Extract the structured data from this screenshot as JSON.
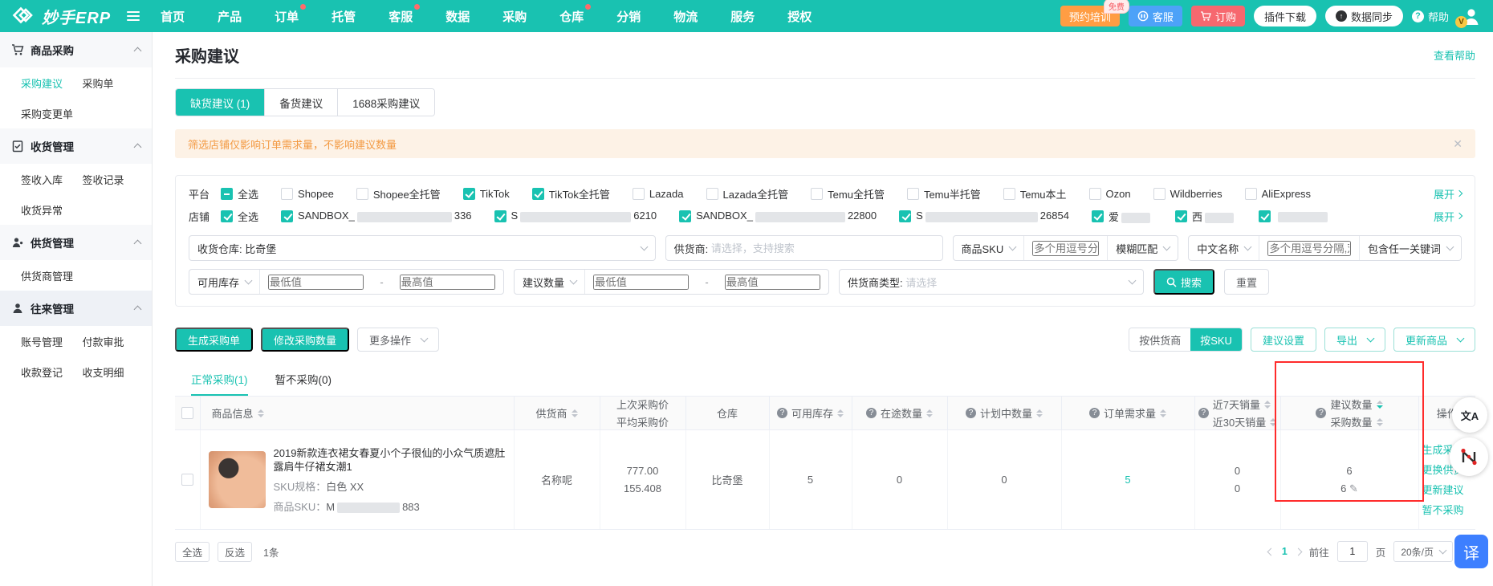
{
  "colors": {
    "accent_teal": "#19c2b1",
    "notice_bg": "#fdf2e6",
    "notice_text": "#f39a43",
    "danger_red": "#f6686f",
    "training_orange": "#ff9d43",
    "support_blue": "#4da2f8",
    "annotation_red": "#ff2b2b",
    "translate_blue": "#3d7fff",
    "badge_yellow": "#f7c843"
  },
  "icons": {
    "q": "?",
    "edit": "✎",
    "help_q": "?",
    "sync_arrow": "↑",
    "close": "✕",
    "translate_round": "文A",
    "translate_fab": "译"
  },
  "topbar": {
    "brand": "妙手ERP",
    "nav": [
      {
        "label": "首页"
      },
      {
        "label": "产品"
      },
      {
        "label": "订单",
        "dot": true
      },
      {
        "label": "托管"
      },
      {
        "label": "客服",
        "dot": true
      },
      {
        "label": "数据"
      },
      {
        "label": "采购"
      },
      {
        "label": "仓库",
        "dot": true
      },
      {
        "label": "分销"
      },
      {
        "label": "物流"
      },
      {
        "label": "服务"
      },
      {
        "label": "授权"
      }
    ],
    "training": "预约培训",
    "training_badge": "免费",
    "support": "客服",
    "order": "订购",
    "plugin": "插件下载",
    "sync": "数据同步",
    "help": "帮助",
    "avatar_badge": "V"
  },
  "sidebar": {
    "groups": [
      {
        "title": "商品采购"
      },
      {
        "title": "收货管理"
      },
      {
        "title": "供货管理"
      },
      {
        "title": "往来管理"
      }
    ],
    "links": {
      "purchase_suggest": "采购建议",
      "purchase_order": "采购单",
      "purchase_change": "采购变更单",
      "receive_in": "签收入库",
      "receive_record": "签收记录",
      "receive_abnormal": "收货异常",
      "supplier_manage": "供货商管理",
      "account_manage": "账号管理",
      "payment_approve": "付款审批",
      "receipt_register": "收款登记",
      "balance_detail": "收支明细"
    }
  },
  "page": {
    "title": "采购建议",
    "help_link": "查看帮助"
  },
  "tabs": [
    {
      "label": "缺货建议 (1)"
    },
    {
      "label": "备货建议"
    },
    {
      "label": "1688采购建议"
    }
  ],
  "notice": {
    "text": "筛选店铺仅影响订单需求量，不影响建议数量"
  },
  "filters": {
    "platform": {
      "label": "平台",
      "select_all": "全选",
      "expand": "展开",
      "options": [
        {
          "label": "Shopee",
          "checked": false
        },
        {
          "label": "Shopee全托管",
          "checked": false
        },
        {
          "label": "TikTok",
          "checked": true
        },
        {
          "label": "TikTok全托管",
          "checked": true
        },
        {
          "label": "Lazada",
          "checked": false
        },
        {
          "label": "Lazada全托管",
          "checked": false
        },
        {
          "label": "Temu全托管",
          "checked": false
        },
        {
          "label": "Temu半托管",
          "checked": false
        },
        {
          "label": "Temu本土",
          "checked": false
        },
        {
          "label": "Ozon",
          "checked": false
        },
        {
          "label": "Wildberries",
          "checked": false
        },
        {
          "label": "AliExpress",
          "checked": false
        }
      ]
    },
    "store": {
      "label": "店铺",
      "select_all": "全选",
      "expand": "展开",
      "options": [
        {
          "prefix": "SANDBOX_",
          "suffix": "336"
        },
        {
          "prefix": "S",
          "suffix": "6210"
        },
        {
          "prefix": "SANDBOX_",
          "suffix": "22800"
        },
        {
          "prefix": "S",
          "suffix": "26854"
        },
        {
          "prefix": "爱",
          "suffix": ""
        },
        {
          "prefix": "西",
          "suffix": ""
        },
        {
          "prefix": "",
          "suffix": ""
        }
      ]
    },
    "warehouse": {
      "label": "收货仓库:",
      "value": "比奇堡"
    },
    "supplier": {
      "label": "供货商:",
      "placeholder": "请选择，支持搜索"
    },
    "sku": {
      "field": "商品SKU",
      "placeholder": "多个用逗号分隔,双击输入更多",
      "match": "模糊匹配"
    },
    "cname": {
      "field": "中文名称",
      "placeholder": "多个用逗号分隔,双击输入",
      "match": "包含任一关键词"
    },
    "stock_range": {
      "field": "可用库存",
      "min_placeholder": "最低值",
      "sep": "-",
      "max_placeholder": "最高值"
    },
    "suggest_range": {
      "field": "建议数量",
      "min_placeholder": "最低值",
      "sep": "-",
      "max_placeholder": "最高值"
    },
    "supplier_type": {
      "label": "供货商类型:",
      "placeholder": "请选择"
    },
    "search": "搜索",
    "reset": "重置"
  },
  "toolbar": {
    "generate": "生成采购单",
    "modify": "修改采购数量",
    "more": "更多操作",
    "by_supplier": "按供货商",
    "by_sku": "按SKU",
    "suggest_settings": "建议设置",
    "export": "导出",
    "update_product": "更新商品"
  },
  "subtabs": [
    {
      "label": "正常采购(1)"
    },
    {
      "label": "暂不采购(0)"
    }
  ],
  "columns": {
    "product": "商品信息",
    "supplier": "供货商",
    "last_price": "上次采购价",
    "avg_price": "平均采购价",
    "warehouse": "仓库",
    "available": "可用库存",
    "in_transit": "在途数量",
    "planned": "计划中数量",
    "order_demand": "订单需求量",
    "sales_7d": "近7天销量",
    "sales_30d": "近30天销量",
    "suggested": "建议数量",
    "purchase": "采购数量",
    "ops": "操作"
  },
  "row": {
    "title": "2019新款连衣裙女春夏小个子很仙的小众气质遮肚露肩牛仔裙女潮1",
    "sku_spec_label": "SKU规格：",
    "sku_spec": "白色 XX",
    "sku_label": "商品SKU：",
    "sku_prefix": "M",
    "sku_suffix": "883",
    "supplier": "名称呢",
    "last_price": "777.00",
    "avg_price": "155.408",
    "warehouse": "比奇堡",
    "available": "5",
    "in_transit": "0",
    "planned": "0",
    "order_demand": "5",
    "sales_7d": "0",
    "sales_30d": "0",
    "suggested": "6",
    "purchase_qty": "6",
    "actions": [
      "生成采购单",
      "更换供货商",
      "更新建议",
      "暂不采购"
    ]
  },
  "footer": {
    "select_all": "全选",
    "invert": "反选",
    "count": "1条",
    "page": "1",
    "goto": "前往",
    "goto_value": "1",
    "page_unit": "页",
    "page_size": "20条/页"
  }
}
